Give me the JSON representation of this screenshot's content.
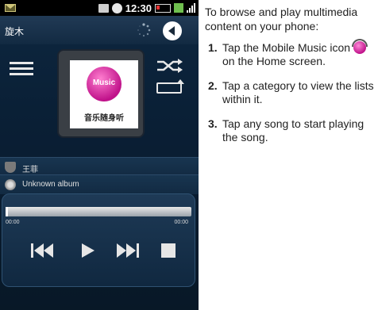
{
  "status_bar": {
    "time": "12:30",
    "icons": [
      "mail-icon",
      "gallery-icon",
      "phone-icon",
      "battery-icon",
      "data-icon",
      "signal-icon"
    ]
  },
  "title_bar": {
    "title": "旋木",
    "back_icon": "back-arrow-icon"
  },
  "album": {
    "cover_label": "Music",
    "cover_caption": "音乐随身听"
  },
  "track": {
    "artist": "王菲",
    "album": "Unknown album"
  },
  "player": {
    "elapsed": "00:00",
    "duration": "00:00",
    "progress": 0.0,
    "controls": [
      "previous-icon",
      "play-icon",
      "next-icon",
      "stop-icon"
    ]
  },
  "instructions": {
    "intro": "To browse and play multimedia content on your phone:",
    "steps": [
      {
        "num": "1.",
        "before": "Tap the Mobile Music icon",
        "after": "on the Home screen."
      },
      {
        "num": "2.",
        "text": "Tap a category to view the lists within it."
      },
      {
        "num": "3.",
        "text": "Tap any song to start playing the song."
      }
    ]
  },
  "colors": {
    "screen_bg": "#0d2740",
    "accent_pink": "#c0128a",
    "status_bar": "#000000"
  }
}
